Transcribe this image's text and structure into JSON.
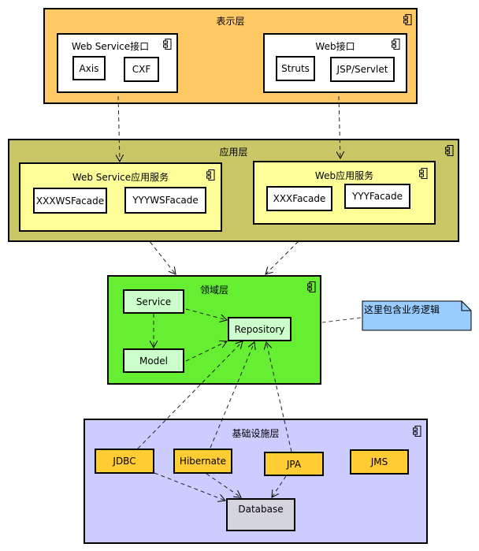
{
  "colors": {
    "presentation_fill": "#FFC966",
    "application_fill": "#C9C666",
    "application_inner_fill": "#FFFF99",
    "domain_fill": "#66EE33",
    "domain_inner_fill": "#CCFFCC",
    "infrastructure_fill": "#CCCCFF",
    "infra_component_fill": "#FFCC33",
    "database_fill": "#D4D4DC",
    "note_fill": "#99CCFF",
    "white": "#FFFFFF"
  },
  "icons": {
    "component": "uml-component-icon"
  },
  "presentation": {
    "title": "表示层",
    "webservice": {
      "title": "Web Service接口",
      "items": [
        "Axis",
        "CXF"
      ]
    },
    "web": {
      "title": "Web接口",
      "items": [
        "Struts",
        "JSP/Servlet"
      ]
    }
  },
  "application": {
    "title": "应用层",
    "webservice": {
      "title": "Web Service应用服务",
      "items": [
        "XXXWSFacade",
        "YYYWSFacade"
      ]
    },
    "web": {
      "title": "Web应用服务",
      "items": [
        "XXXFacade",
        "YYYFacade"
      ]
    }
  },
  "domain": {
    "title": "领域层",
    "items": [
      "Service",
      "Model",
      "Repository"
    ]
  },
  "note": {
    "text": "这里包含业务逻辑"
  },
  "infrastructure": {
    "title": "基础设施层",
    "items": [
      "JDBC",
      "Hibernate",
      "JPA",
      "JMS",
      "Database"
    ]
  },
  "dependencies": [
    {
      "from": "Web Service接口",
      "to": "Web Service应用服务"
    },
    {
      "from": "Web接口",
      "to": "Web应用服务"
    },
    {
      "from": "应用层",
      "to": "领域层"
    },
    {
      "from": "Service",
      "to": "Model"
    },
    {
      "from": "Service",
      "to": "Repository"
    },
    {
      "from": "Model",
      "to": "Repository"
    },
    {
      "from": "JDBC",
      "to": "Repository"
    },
    {
      "from": "Hibernate",
      "to": "Repository"
    },
    {
      "from": "JPA",
      "to": "Repository"
    },
    {
      "from": "JDBC",
      "to": "Database"
    },
    {
      "from": "Hibernate",
      "to": "Database"
    },
    {
      "from": "JPA",
      "to": "Database"
    },
    {
      "from": "这里包含业务逻辑",
      "to": "领域层"
    }
  ]
}
